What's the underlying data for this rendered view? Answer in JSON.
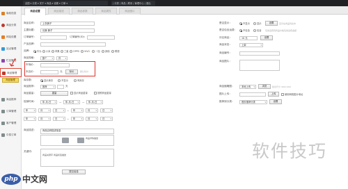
{
  "topbar": {
    "text": "全国 ▾  分类 ▾  关于 ▾  商品 ▾  设置 ▾  订单 ▾",
    "right_text": "| 分类 | 商品 | 联系 | 管理中心 | 退出"
  },
  "sidebar": {
    "items": [
      {
        "label": "版权信息",
        "color": "#d9822b"
      },
      {
        "label": "商品分类",
        "color": "#c0392b"
      },
      {
        "label": "网站设置",
        "color": "#e67e22"
      },
      {
        "label": "站点管理",
        "color": "#3498db"
      },
      {
        "label": "栏目管理",
        "color": "#8e44ad"
      },
      {
        "label": "商品管理",
        "color": "#c0392b"
      },
      {
        "label": "商品推荐",
        "color": "#7f8c8d"
      },
      {
        "label": "订单管理",
        "color": "#7f8c8d"
      },
      {
        "label": "客户管理",
        "color": "#7f8c8d"
      },
      {
        "label": "中奖订单",
        "color": "#7f8c8d"
      }
    ],
    "tooltip": "商品管理"
  },
  "tabs": [
    "商品设置",
    "商品描述",
    "商品参数",
    "商品属性",
    "商品图片"
  ],
  "form": {
    "name_label": "商品名称：",
    "name_value": "上衣裤子",
    "title_label": "主要标题：",
    "title_value": "长裤 裤子",
    "code_label": "订单编号：",
    "code_extra": "订单编号(ID)：",
    "brand_label": "产品品牌：",
    "brand_options": [
      "华为",
      "小米",
      "苹果",
      "三星",
      "OPPO",
      "VIVO",
      "一加",
      "其他",
      "联想"
    ],
    "unit_label": "商品规格：",
    "unit_value": "数个",
    "unit_value2": "件",
    "price_label": "市场价：",
    "shop_price_label": "本店价：",
    "shop_price_unit": "元",
    "shop_price_btn": "标价",
    "shop_price_hint": "默认售价",
    "stock_label": "库存数：",
    "stock_options": [
      "显示库存",
      "不显示",
      "有库存"
    ],
    "recommend_label": "商品推荐：",
    "recommend_value": "推荐",
    "recommend_unit": "天",
    "weight_label": "商品重量：",
    "weight_button": "重量",
    "weight_opt1": "显示商品重量",
    "weight_opt2": "按照商品重量",
    "time_label": "促销时间：",
    "time_rows": [
      [
        "年-月-日",
        "—",
        "年-月-日",
        "—",
        "年-月-日"
      ],
      [
        "年",
        "月",
        "日",
        "—",
        "年",
        "月",
        "日"
      ],
      [
        "年",
        "月",
        "日",
        "—",
        "年",
        "月",
        "日"
      ]
    ],
    "desc_label": "商品描述：",
    "desc_text1": "商品名称描述信息",
    "desc_text2": "商品详情描述",
    "keyword_label": "关键词：",
    "keyword_text": "商品关键字  商品标签描述",
    "submit_label": "提交信息"
  },
  "right": {
    "label1": "是否显示：",
    "r1_opt1": "不显示",
    "r1_opt2": "显示",
    "r1_btn": "设置",
    "r1_hint": "显示在商品列表中",
    "label2": "是否包含运费：",
    "r2_opt1": "不包含",
    "r2_opt2": "包含",
    "r2_hint": "包含运费则商品价格包含运费金额",
    "label3": "评论商品：",
    "r3_value": "10 元",
    "r3_btn": "设置",
    "label4": "商品状态：",
    "r4_value": "上架",
    "label5": "商品编号：",
    "label6": "商品图片：",
    "label7": "商品缩略图：",
    "r7_value": "本地上传",
    "r7_btn": "浏览",
    "r7_hint": "建议尺寸 400×400",
    "label8": "图片上传：",
    "r8_btn": "上传",
    "r8_opt": "使用网络图片地址",
    "label9": "推荐到分类：",
    "r9_value": "首页推荐分类",
    "r9_btn": "设置"
  },
  "watermark": {
    "text": "软件技巧",
    "logo_php": "php",
    "logo_cn": "中文网",
    "logo_url": "php.cn"
  }
}
